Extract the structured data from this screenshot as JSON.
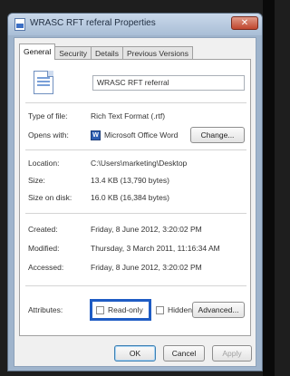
{
  "window": {
    "title": "WRASC RFT referal Properties",
    "close_glyph": "✕"
  },
  "tabs": [
    {
      "label": "General"
    },
    {
      "label": "Security"
    },
    {
      "label": "Details"
    },
    {
      "label": "Previous Versions"
    }
  ],
  "file": {
    "name": "WRASC RFT referral"
  },
  "info": {
    "type_label": "Type of file:",
    "type_value": "Rich Text Format (.rtf)",
    "opens_label": "Opens with:",
    "opens_value": "Microsoft Office Word",
    "change_label": "Change...",
    "location_label": "Location:",
    "location_value": "C:\\Users\\marketing\\Desktop",
    "size_label": "Size:",
    "size_value": "13.4 KB (13,790 bytes)",
    "size_disk_label": "Size on disk:",
    "size_disk_value": "16.0 KB (16,384 bytes)",
    "created_label": "Created:",
    "created_value": "Friday, 8 June 2012, 3:20:02 PM",
    "modified_label": "Modified:",
    "modified_value": "Thursday, 3 March 2011, 11:16:34 AM",
    "accessed_label": "Accessed:",
    "accessed_value": "Friday, 8 June 2012, 3:20:02 PM"
  },
  "attributes": {
    "label": "Attributes:",
    "readonly_label": "Read-only",
    "readonly_checked": false,
    "hidden_label": "Hidden",
    "hidden_checked": false,
    "advanced_label": "Advanced..."
  },
  "buttons": {
    "ok": "OK",
    "cancel": "Cancel",
    "apply": "Apply"
  },
  "colors": {
    "highlight": "#1f5cc4",
    "titlebar": "#b9cbe0"
  }
}
